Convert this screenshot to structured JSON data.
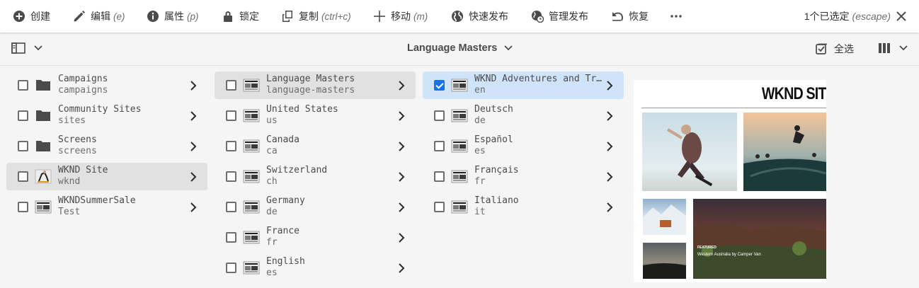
{
  "actionbar": {
    "create": {
      "label": "创建",
      "shortcut": ""
    },
    "edit": {
      "label": "编辑",
      "shortcut": "(e)"
    },
    "properties": {
      "label": "属性",
      "shortcut": "(p)"
    },
    "lock": {
      "label": "锁定",
      "shortcut": ""
    },
    "copy": {
      "label": "复制",
      "shortcut": "(ctrl+c)"
    },
    "move": {
      "label": "移动",
      "shortcut": "(m)"
    },
    "quick_publish": {
      "label": "快速发布",
      "shortcut": ""
    },
    "manage_publication": {
      "label": "管理发布",
      "shortcut": ""
    },
    "restore": {
      "label": "恢复",
      "shortcut": ""
    },
    "more": "…",
    "selection_count": "1个已选定",
    "selection_shortcut": "(escape)"
  },
  "secbar": {
    "breadcrumb": "Language Masters",
    "select_all": "全选"
  },
  "columns": [
    {
      "items": [
        {
          "name": "Campaigns",
          "slug": "campaigns",
          "type": "folder",
          "state": "",
          "checked": false
        },
        {
          "name": "Community Sites",
          "slug": "sites",
          "type": "folder",
          "state": "",
          "checked": false
        },
        {
          "name": "Screens",
          "slug": "screens",
          "type": "folder",
          "state": "",
          "checked": false
        },
        {
          "name": "WKND Site",
          "slug": "wknd",
          "type": "site",
          "state": "active",
          "checked": false
        },
        {
          "name": "WKNDSummerSale",
          "slug": "Test",
          "type": "page",
          "state": "",
          "checked": false
        }
      ]
    },
    {
      "items": [
        {
          "name": "Language Masters",
          "slug": "language-masters",
          "type": "page",
          "state": "active",
          "checked": false
        },
        {
          "name": "United States",
          "slug": "us",
          "type": "page",
          "state": "",
          "checked": false
        },
        {
          "name": "Canada",
          "slug": "ca",
          "type": "page",
          "state": "",
          "checked": false
        },
        {
          "name": "Switzerland",
          "slug": "ch",
          "type": "page",
          "state": "",
          "checked": false
        },
        {
          "name": "Germany",
          "slug": "de",
          "type": "page",
          "state": "",
          "checked": false
        },
        {
          "name": "France",
          "slug": "fr",
          "type": "page",
          "state": "",
          "checked": false
        },
        {
          "name": "English",
          "slug": "es",
          "type": "page",
          "state": "",
          "checked": false
        }
      ]
    },
    {
      "items": [
        {
          "name": "WKND Adventures and Tr…",
          "slug": "en",
          "type": "page",
          "state": "selected",
          "checked": true
        },
        {
          "name": "Deutsch",
          "slug": "de",
          "type": "page",
          "state": "",
          "checked": false
        },
        {
          "name": "Español",
          "slug": "es",
          "type": "page",
          "state": "",
          "checked": false
        },
        {
          "name": "Français",
          "slug": "fr",
          "type": "page",
          "state": "",
          "checked": false
        },
        {
          "name": "Italiano",
          "slug": "it",
          "type": "page",
          "state": "",
          "checked": false
        }
      ]
    }
  ],
  "preview": {
    "site_title": "WKND SIT",
    "featured_label": "FEATURED",
    "featured_title": "Western Australia by Camper Van"
  },
  "colors": {
    "accent": "#1473e6",
    "selected_row": "#cfe3f9",
    "active_row": "#e1e1e1",
    "panel_bg": "#f5f5f5"
  }
}
